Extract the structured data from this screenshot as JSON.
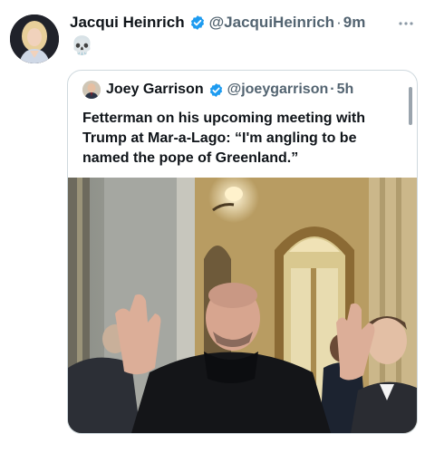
{
  "tweet": {
    "author_name": "Jacqui Heinrich",
    "author_handle": "@JacquiHeinrich",
    "separator": "·",
    "time": "9m",
    "text": "💀",
    "more_icon": "more-icon"
  },
  "quoted_tweet": {
    "author_name": "Joey Garrison",
    "author_handle": "@joeygarrison",
    "separator": "·",
    "time": "5h",
    "text": "Fetterman on his upcoming meeting with Trump at Mar-a-Lago: “I'm angling to be named the pope of Greenland.”"
  },
  "colors": {
    "verified_blue": "#1d9bf0",
    "secondary_text": "#536471",
    "border": "#cfd9de"
  }
}
